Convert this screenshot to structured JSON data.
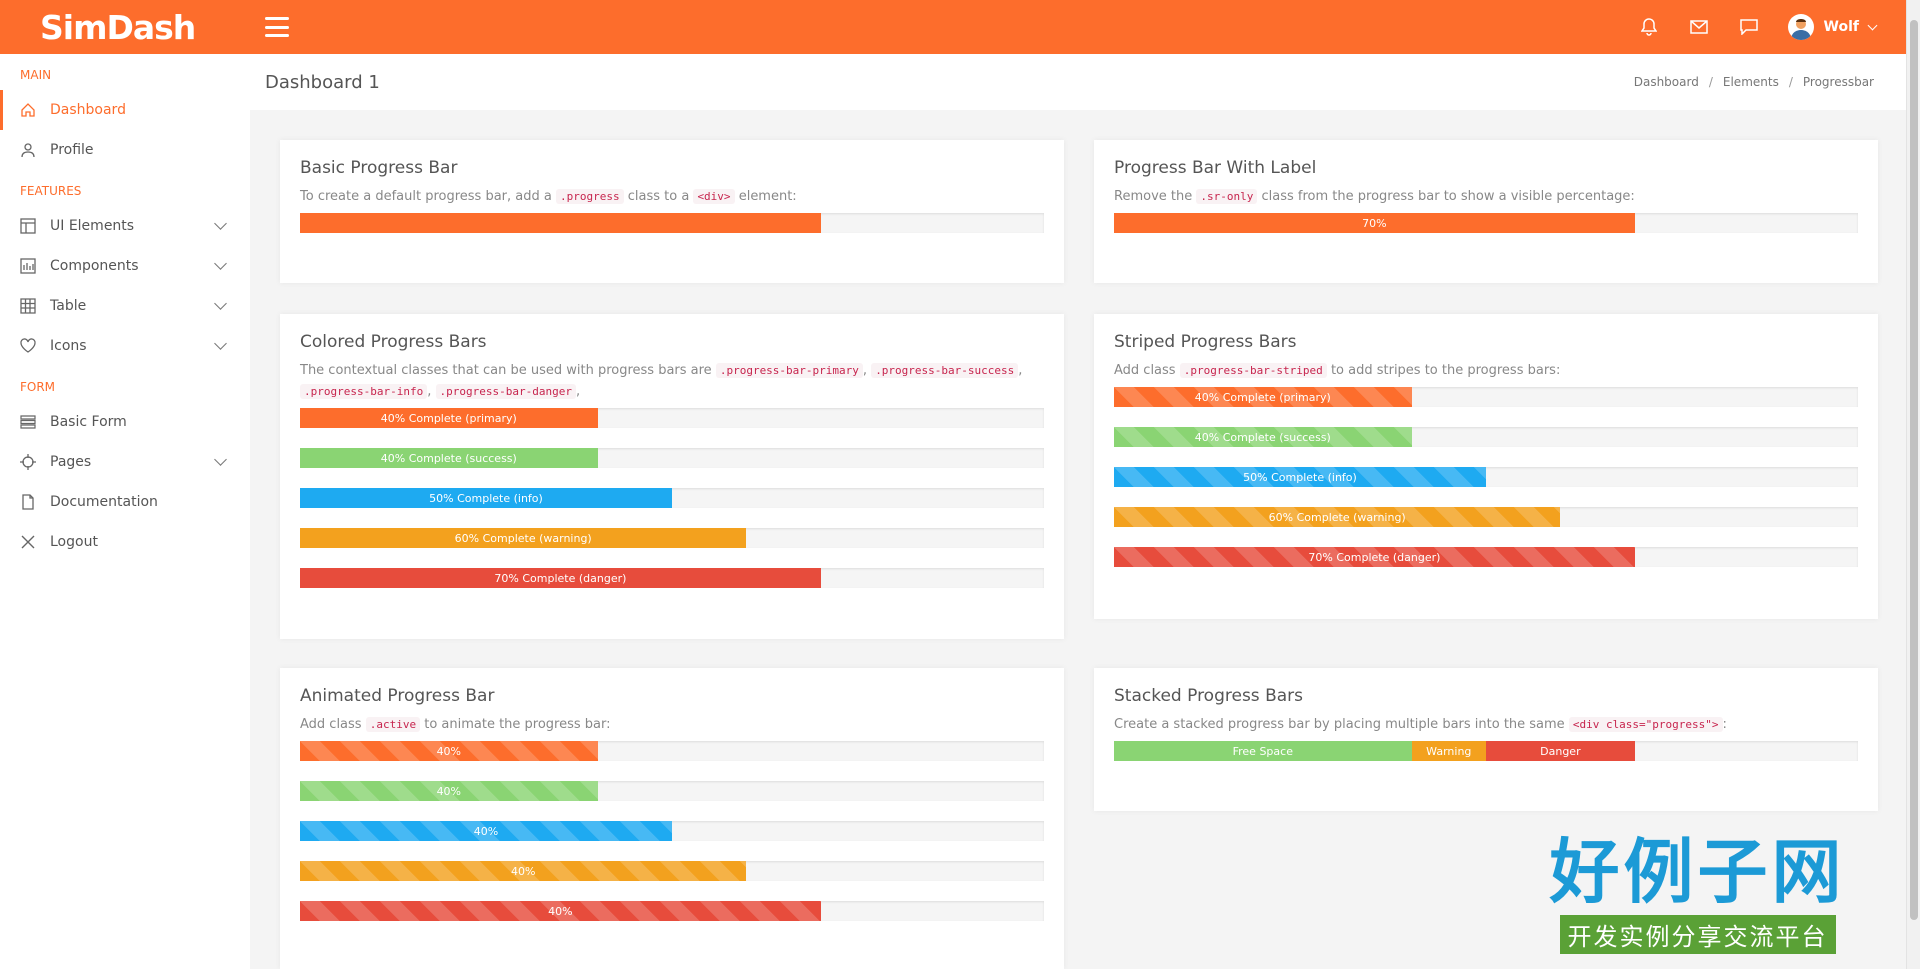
{
  "app": {
    "logo": "SimDash"
  },
  "topbar": {
    "user_name": "Wolf"
  },
  "sidebar": {
    "sections": [
      {
        "title": "MAIN",
        "items": [
          {
            "label": "Dashboard",
            "icon": "home-icon",
            "active": true
          },
          {
            "label": "Profile",
            "icon": "user-icon"
          }
        ]
      },
      {
        "title": "FEATURES",
        "items": [
          {
            "label": "UI Elements",
            "icon": "layout-icon",
            "chevron": true
          },
          {
            "label": "Components",
            "icon": "chart-icon",
            "chevron": true
          },
          {
            "label": "Table",
            "icon": "grid-icon",
            "chevron": true
          },
          {
            "label": "Icons",
            "icon": "heart-icon",
            "chevron": true
          }
        ]
      },
      {
        "title": "FORM",
        "items": [
          {
            "label": "Basic Form",
            "icon": "list-icon"
          },
          {
            "label": "Pages",
            "icon": "crosshair-icon",
            "chevron": true
          },
          {
            "label": "Documentation",
            "icon": "file-icon"
          },
          {
            "label": "Logout",
            "icon": "close-icon"
          }
        ]
      }
    ]
  },
  "page": {
    "title": "Dashboard 1",
    "breadcrumb": [
      "Dashboard",
      "Elements",
      "Progressbar"
    ]
  },
  "cards": {
    "basic": {
      "title": "Basic Progress Bar",
      "desc_1": "To create a default progress bar, add a",
      "code_1": ".progress",
      "desc_2": "class to a",
      "code_2": "<div>",
      "desc_3": "element:",
      "value": 70
    },
    "label": {
      "title": "Progress Bar With Label",
      "desc_1": "Remove the",
      "code_1": ".sr-only",
      "desc_2": "class from the progress bar to show a visible percentage:",
      "value": 70,
      "bar_label": "70%"
    },
    "colored": {
      "title": "Colored Progress Bars",
      "desc_1": "The contextual classes that can be used with progress bars are",
      "code_1": ".progress-bar-primary",
      "sep_1": ",",
      "code_2": ".progress-bar-success",
      "sep_2": ",",
      "code_3": ".progress-bar-info",
      "sep_3": ",",
      "code_4": ".progress-bar-danger",
      "sep_4": ",",
      "bars": [
        {
          "label": "40% Complete (primary)",
          "value": 40,
          "color": "#fd6d2c"
        },
        {
          "label": "40% Complete (success)",
          "value": 40,
          "color": "#8ad473"
        },
        {
          "label": "50% Complete (info)",
          "value": 50,
          "color": "#1eaaf1"
        },
        {
          "label": "60% Complete (warning)",
          "value": 60,
          "color": "#f3a11e"
        },
        {
          "label": "70% Complete (danger)",
          "value": 70,
          "color": "#e74c3c"
        }
      ]
    },
    "striped": {
      "title": "Striped Progress Bars",
      "desc_1": "Add class",
      "code_1": ".progress-bar-striped",
      "desc_2": "to add stripes to the progress bars:",
      "bars": [
        {
          "label": "40% Complete (primary)",
          "value": 40,
          "color": "#fd6d2c"
        },
        {
          "label": "40% Complete (success)",
          "value": 40,
          "color": "#8ad473"
        },
        {
          "label": "50% Complete (info)",
          "value": 50,
          "color": "#1eaaf1"
        },
        {
          "label": "60% Complete (warning)",
          "value": 60,
          "color": "#f3a11e"
        },
        {
          "label": "70% Complete (danger)",
          "value": 70,
          "color": "#e74c3c"
        }
      ]
    },
    "animated": {
      "title": "Animated Progress Bar",
      "desc_1": "Add class",
      "code_1": ".active",
      "desc_2": "to animate the progress bar:",
      "bars": [
        {
          "label": "40%",
          "value": 40,
          "color": "#fd6d2c"
        },
        {
          "label": "40%",
          "value": 40,
          "color": "#8ad473"
        },
        {
          "label": "40%",
          "value": 50,
          "color": "#1eaaf1"
        },
        {
          "label": "40%",
          "value": 60,
          "color": "#f3a11e"
        },
        {
          "label": "40%",
          "value": 70,
          "color": "#e74c3c"
        }
      ]
    },
    "stacked": {
      "title": "Stacked Progress Bars",
      "desc_1": "Create a stacked progress bar by placing multiple bars into the same",
      "code_1": "<div class=\"progress\">",
      "desc_2": ":",
      "segments": [
        {
          "label": "Free Space",
          "value": 40,
          "color": "#8ad473"
        },
        {
          "label": "Warning",
          "value": 10,
          "color": "#f3a11e"
        },
        {
          "label": "Danger",
          "value": 20,
          "color": "#e74c3c"
        }
      ]
    }
  },
  "watermark": {
    "big": "好例子网",
    "small": "开发实例分享交流平台"
  }
}
